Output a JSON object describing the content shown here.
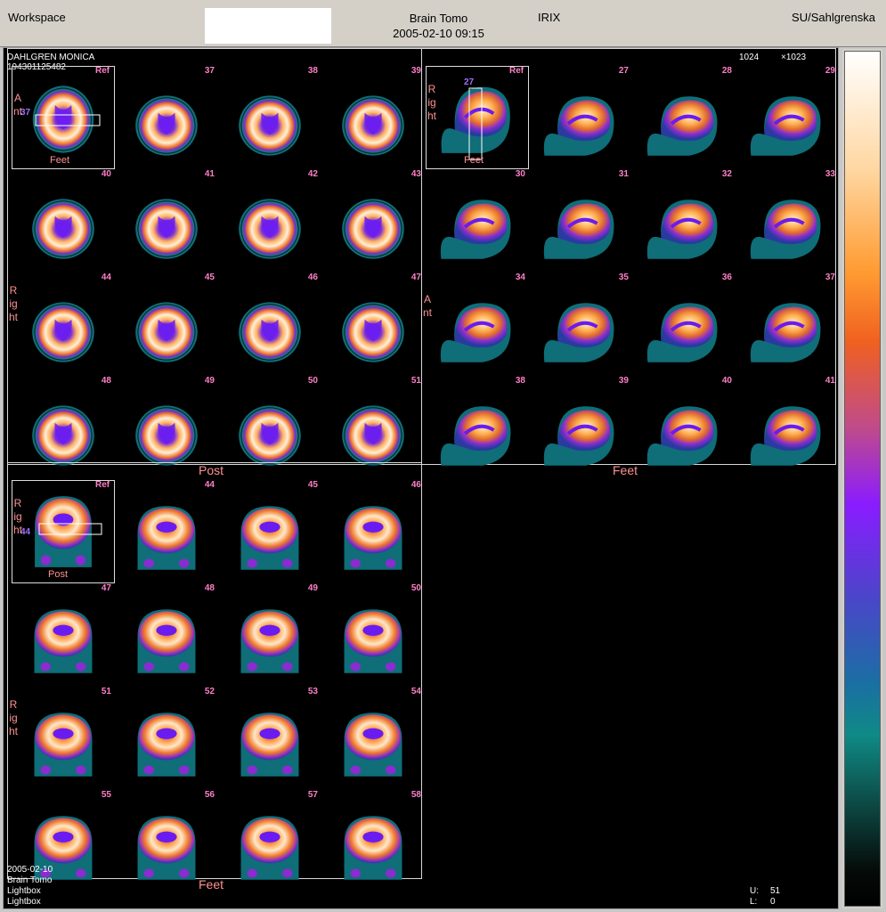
{
  "header": {
    "workspace": "Workspace",
    "study_title": "Brain Tomo",
    "study_datetime": "2005-02-10 09:15",
    "app": "IRIX",
    "site": "SU/Sahlgrenska"
  },
  "patient": {
    "name": "DAHLGREN MONICA",
    "id": "194301125482",
    "matrix_a": "1024",
    "matrix_b": "×1023"
  },
  "footer": {
    "date": "2005-02-10",
    "study": "Brain Tomo",
    "mode1": "Lightbox",
    "mode2": "Lightbox",
    "upper_label": "U:",
    "upper_value": "51",
    "lower_label": "L:",
    "lower_value": "0"
  },
  "panels": {
    "transverse": {
      "ref": "Ref",
      "ref_slice": "37",
      "ref_left": "Ant",
      "ref_bottom": "Feet",
      "side": "Right",
      "bottom": "Post",
      "slices": [
        "37",
        "38",
        "39",
        "40",
        "41",
        "42",
        "43",
        "44",
        "45",
        "46",
        "47",
        "48",
        "49",
        "50",
        "51"
      ]
    },
    "sagittal": {
      "ref": "Ref",
      "ref_slice": "27",
      "ref_left": "Right",
      "ref_bottom": "Feet",
      "side": "Ant",
      "bottom": "Feet",
      "slices": [
        "27",
        "28",
        "29",
        "30",
        "31",
        "32",
        "33",
        "34",
        "35",
        "36",
        "37",
        "38",
        "39",
        "40",
        "41"
      ]
    },
    "coronal": {
      "ref": "Ref",
      "ref_slice": "44",
      "ref_left": "Right",
      "ref_bottom": "Post",
      "side": "Right",
      "bottom": "Feet",
      "slices": [
        "44",
        "45",
        "46",
        "47",
        "48",
        "49",
        "50",
        "51",
        "52",
        "53",
        "54",
        "55",
        "56",
        "57",
        "58"
      ]
    }
  }
}
